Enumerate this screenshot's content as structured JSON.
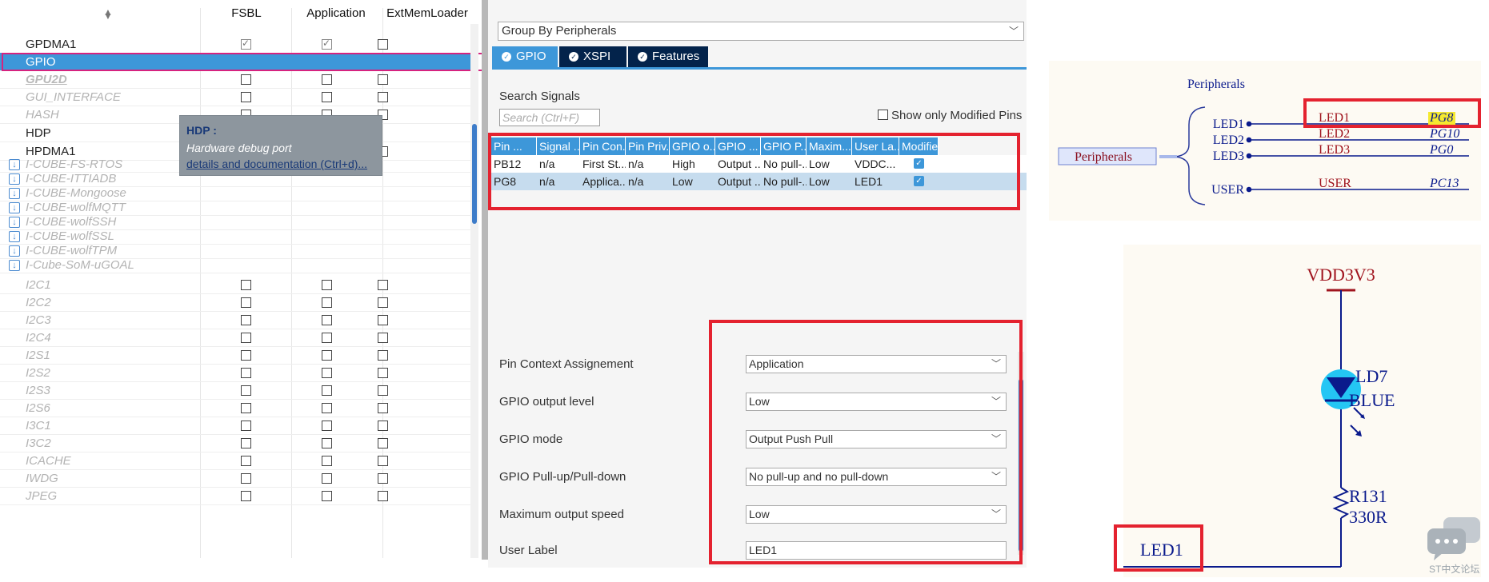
{
  "left_panel": {
    "sort_icon": "sort-arrows-icon",
    "columns": [
      "FSBL",
      "Application",
      "ExtMemLoader"
    ],
    "rows": [
      {
        "name": "GPDMA1",
        "style": "active",
        "fsbl": "checked",
        "app": "checked",
        "ext": "empty"
      },
      {
        "name": "GPIO",
        "style": "selected",
        "fsbl": "none",
        "app": "none",
        "ext": "none"
      },
      {
        "name": "GPU2D",
        "style": "link",
        "fsbl": "empty",
        "app": "empty",
        "ext": "empty"
      },
      {
        "name": "GUI_INTERFACE",
        "style": "disabled",
        "fsbl": "empty",
        "app": "empty",
        "ext": "empty"
      },
      {
        "name": "HASH",
        "style": "disabled",
        "fsbl": "empty",
        "app": "empty",
        "ext": "empty"
      },
      {
        "name": "HDP",
        "style": "active",
        "fsbl": "none",
        "app": "none",
        "ext": "none"
      },
      {
        "name": "HPDMA1",
        "style": "active",
        "fsbl": "none",
        "app": "none",
        "ext": "empty"
      },
      {
        "name": "I-CUBE-FS-RTOS",
        "style": "pack",
        "fsbl": "none",
        "app": "none",
        "ext": "none"
      },
      {
        "name": "I-CUBE-ITTIADB",
        "style": "pack",
        "fsbl": "none",
        "app": "none",
        "ext": "none"
      },
      {
        "name": "I-CUBE-Mongoose",
        "style": "pack",
        "fsbl": "none",
        "app": "none",
        "ext": "none"
      },
      {
        "name": "I-CUBE-wolfMQTT",
        "style": "pack",
        "fsbl": "none",
        "app": "none",
        "ext": "none"
      },
      {
        "name": "I-CUBE-wolfSSH",
        "style": "pack",
        "fsbl": "none",
        "app": "none",
        "ext": "none"
      },
      {
        "name": "I-CUBE-wolfSSL",
        "style": "pack",
        "fsbl": "none",
        "app": "none",
        "ext": "none"
      },
      {
        "name": "I-CUBE-wolfTPM",
        "style": "pack",
        "fsbl": "none",
        "app": "none",
        "ext": "none"
      },
      {
        "name": "I-Cube-SoM-uGOAL",
        "style": "pack",
        "fsbl": "none",
        "app": "none",
        "ext": "none"
      },
      {
        "name": "I2C1",
        "style": "disabled",
        "fsbl": "empty",
        "app": "empty",
        "ext": "empty"
      },
      {
        "name": "I2C2",
        "style": "disabled",
        "fsbl": "empty",
        "app": "empty",
        "ext": "empty"
      },
      {
        "name": "I2C3",
        "style": "disabled",
        "fsbl": "empty",
        "app": "empty",
        "ext": "empty"
      },
      {
        "name": "I2C4",
        "style": "disabled",
        "fsbl": "empty",
        "app": "empty",
        "ext": "empty"
      },
      {
        "name": "I2S1",
        "style": "disabled",
        "fsbl": "empty",
        "app": "empty",
        "ext": "empty"
      },
      {
        "name": "I2S2",
        "style": "disabled",
        "fsbl": "empty",
        "app": "empty",
        "ext": "empty"
      },
      {
        "name": "I2S3",
        "style": "disabled",
        "fsbl": "empty",
        "app": "empty",
        "ext": "empty"
      },
      {
        "name": "I2S6",
        "style": "disabled",
        "fsbl": "empty",
        "app": "empty",
        "ext": "empty"
      },
      {
        "name": "I3C1",
        "style": "disabled",
        "fsbl": "empty",
        "app": "empty",
        "ext": "empty"
      },
      {
        "name": "I3C2",
        "style": "disabled",
        "fsbl": "empty",
        "app": "empty",
        "ext": "empty"
      },
      {
        "name": "ICACHE",
        "style": "disabled",
        "fsbl": "empty",
        "app": "empty",
        "ext": "empty"
      },
      {
        "name": "IWDG",
        "style": "disabled",
        "fsbl": "empty",
        "app": "empty",
        "ext": "empty"
      },
      {
        "name": "JPEG",
        "style": "disabled",
        "fsbl": "empty",
        "app": "empty",
        "ext": "empty"
      }
    ],
    "tooltip": {
      "title": "HDP :",
      "description": "Hardware debug port",
      "link": "details and documentation (Ctrl+d)..."
    }
  },
  "middle_panel": {
    "group_by": "Group By Peripherals",
    "tabs": [
      {
        "label": "GPIO",
        "icon": "check-circle-icon",
        "active": true
      },
      {
        "label": "XSPI",
        "icon": "check-circle-icon",
        "active": false
      },
      {
        "label": "Features",
        "icon": "check-circle-icon",
        "active": false
      }
    ],
    "search_label": "Search Signals",
    "search_placeholder": "Search (Ctrl+F)",
    "modified_label": "Show only Modified Pins",
    "table": {
      "headers": [
        "Pin ...",
        "Signal ...",
        "Pin Con...",
        "Pin Priv...",
        "GPIO o...",
        "GPIO ...",
        "GPIO P...",
        "Maxim...",
        "User La...",
        "Modified"
      ],
      "rows": [
        {
          "cells": [
            "PB12",
            "n/a",
            "First St...",
            "n/a",
            "High",
            "Output ...",
            "No pull-...",
            "Low",
            "VDDC..."
          ],
          "modified": true,
          "selected": false
        },
        {
          "cells": [
            "PG8",
            "n/a",
            "Applica...",
            "n/a",
            "Low",
            "Output ...",
            "No pull-...",
            "Low",
            "LED1"
          ],
          "modified": true,
          "selected": true
        }
      ]
    },
    "properties": [
      {
        "label": "Pin Context Assignement",
        "value": "Application",
        "kind": "select"
      },
      {
        "label": "GPIO output level",
        "value": "Low",
        "kind": "select"
      },
      {
        "label": "GPIO mode",
        "value": "Output Push Pull",
        "kind": "select"
      },
      {
        "label": "GPIO Pull-up/Pull-down",
        "value": "No pull-up and no pull-down",
        "kind": "select"
      },
      {
        "label": "Maximum output speed",
        "value": "Low",
        "kind": "select"
      },
      {
        "label": "User Label",
        "value": "LED1",
        "kind": "input"
      }
    ]
  },
  "schematic_top": {
    "title": "Peripherals",
    "bus_label": "Peripherals",
    "pins": [
      "LED1",
      "LED2",
      "LED3",
      "USER"
    ],
    "nets": [
      {
        "name": "LED1",
        "port": "PG8"
      },
      {
        "name": "LED2",
        "port": "PG10"
      },
      {
        "name": "LED3",
        "port": "PG0"
      },
      {
        "name": "USER",
        "port": "PC13"
      }
    ]
  },
  "schematic_bottom": {
    "supply": "VDD3V3",
    "led_ref": "LD7",
    "led_color": "BLUE",
    "resistor_ref": "R131",
    "resistor_value": "330R",
    "net_label": "LED1"
  },
  "watermark": {
    "text": "ST中文论坛",
    "icon": "chat-bubbles-icon"
  },
  "colors": {
    "accent": "#3d97d9",
    "tab_dark": "#03234b",
    "highlight_red": "#e4222f",
    "gpio_outline": "#d6237f",
    "schematic_blue": "#0a1a8c",
    "schematic_red": "#a0141e"
  }
}
